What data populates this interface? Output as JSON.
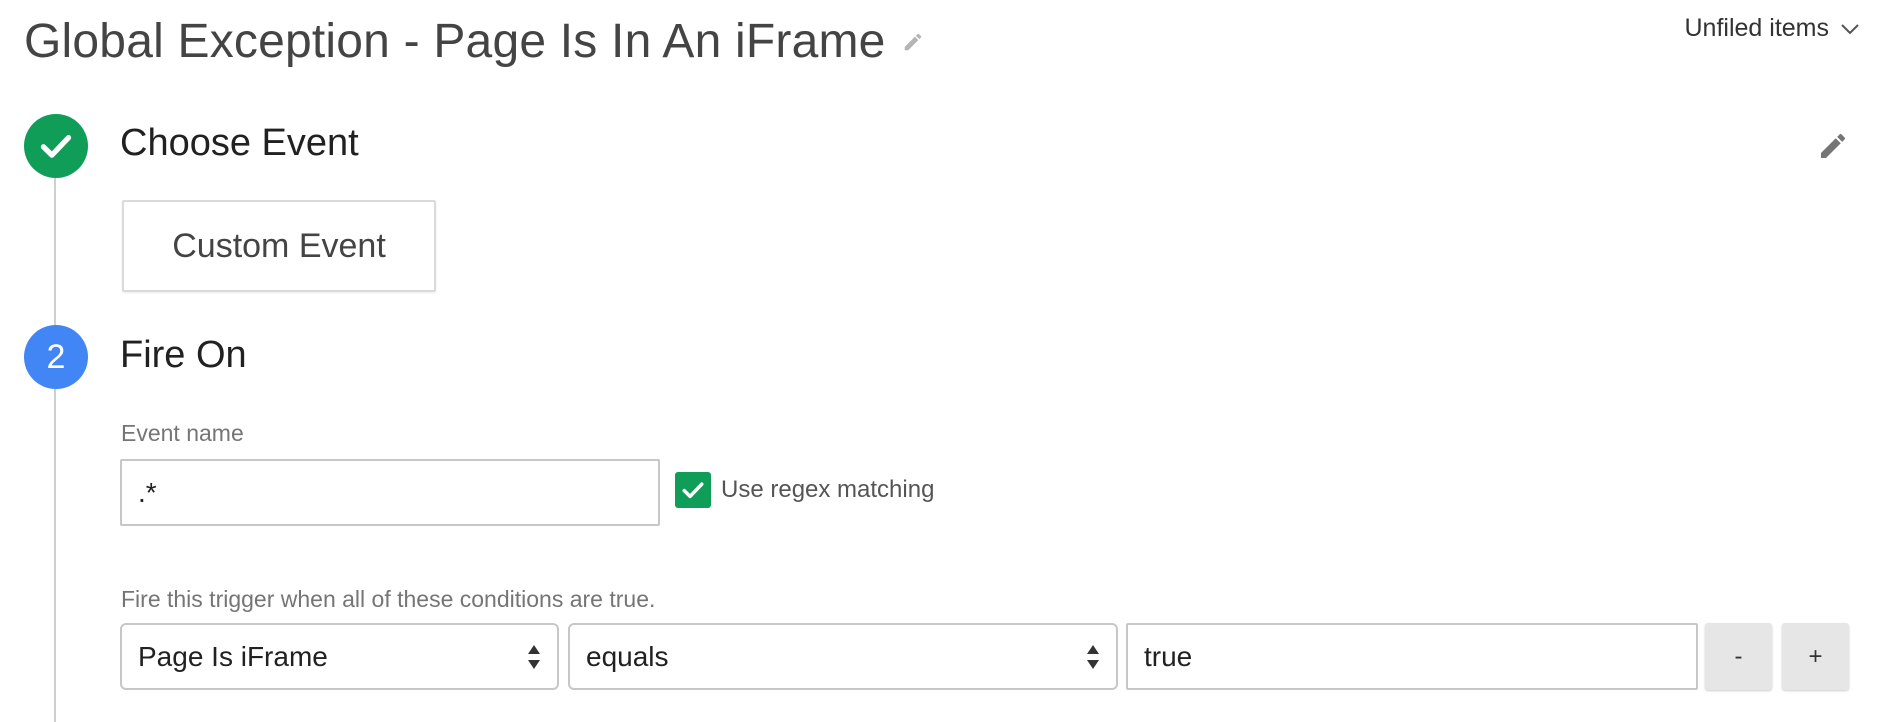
{
  "header": {
    "title": "Global Exception - Page Is In An iFrame",
    "folder_label": "Unfiled items"
  },
  "steps": [
    {
      "status": "complete",
      "title": "Choose Event",
      "event_type": "Custom Event"
    },
    {
      "number": "2",
      "status": "active",
      "title": "Fire On",
      "event_name_label": "Event name",
      "event_name_value": ".*",
      "regex_label": "Use regex matching",
      "regex_checked": true,
      "conditions_label": "Fire this trigger when all of these conditions are true.",
      "condition": {
        "variable": "Page Is iFrame",
        "operator": "equals",
        "value": "true"
      },
      "remove_label": "-",
      "add_label": "+"
    }
  ],
  "colors": {
    "step_complete": "#0f9d58",
    "step_active": "#4285f4",
    "checkbox": "#0f9d58"
  },
  "icons": {
    "title_edit": "pencil-icon",
    "folder": "chevron-down-icon",
    "step_complete": "check-icon",
    "step_edit": "pencil-icon",
    "select": "select-arrows-icon"
  }
}
